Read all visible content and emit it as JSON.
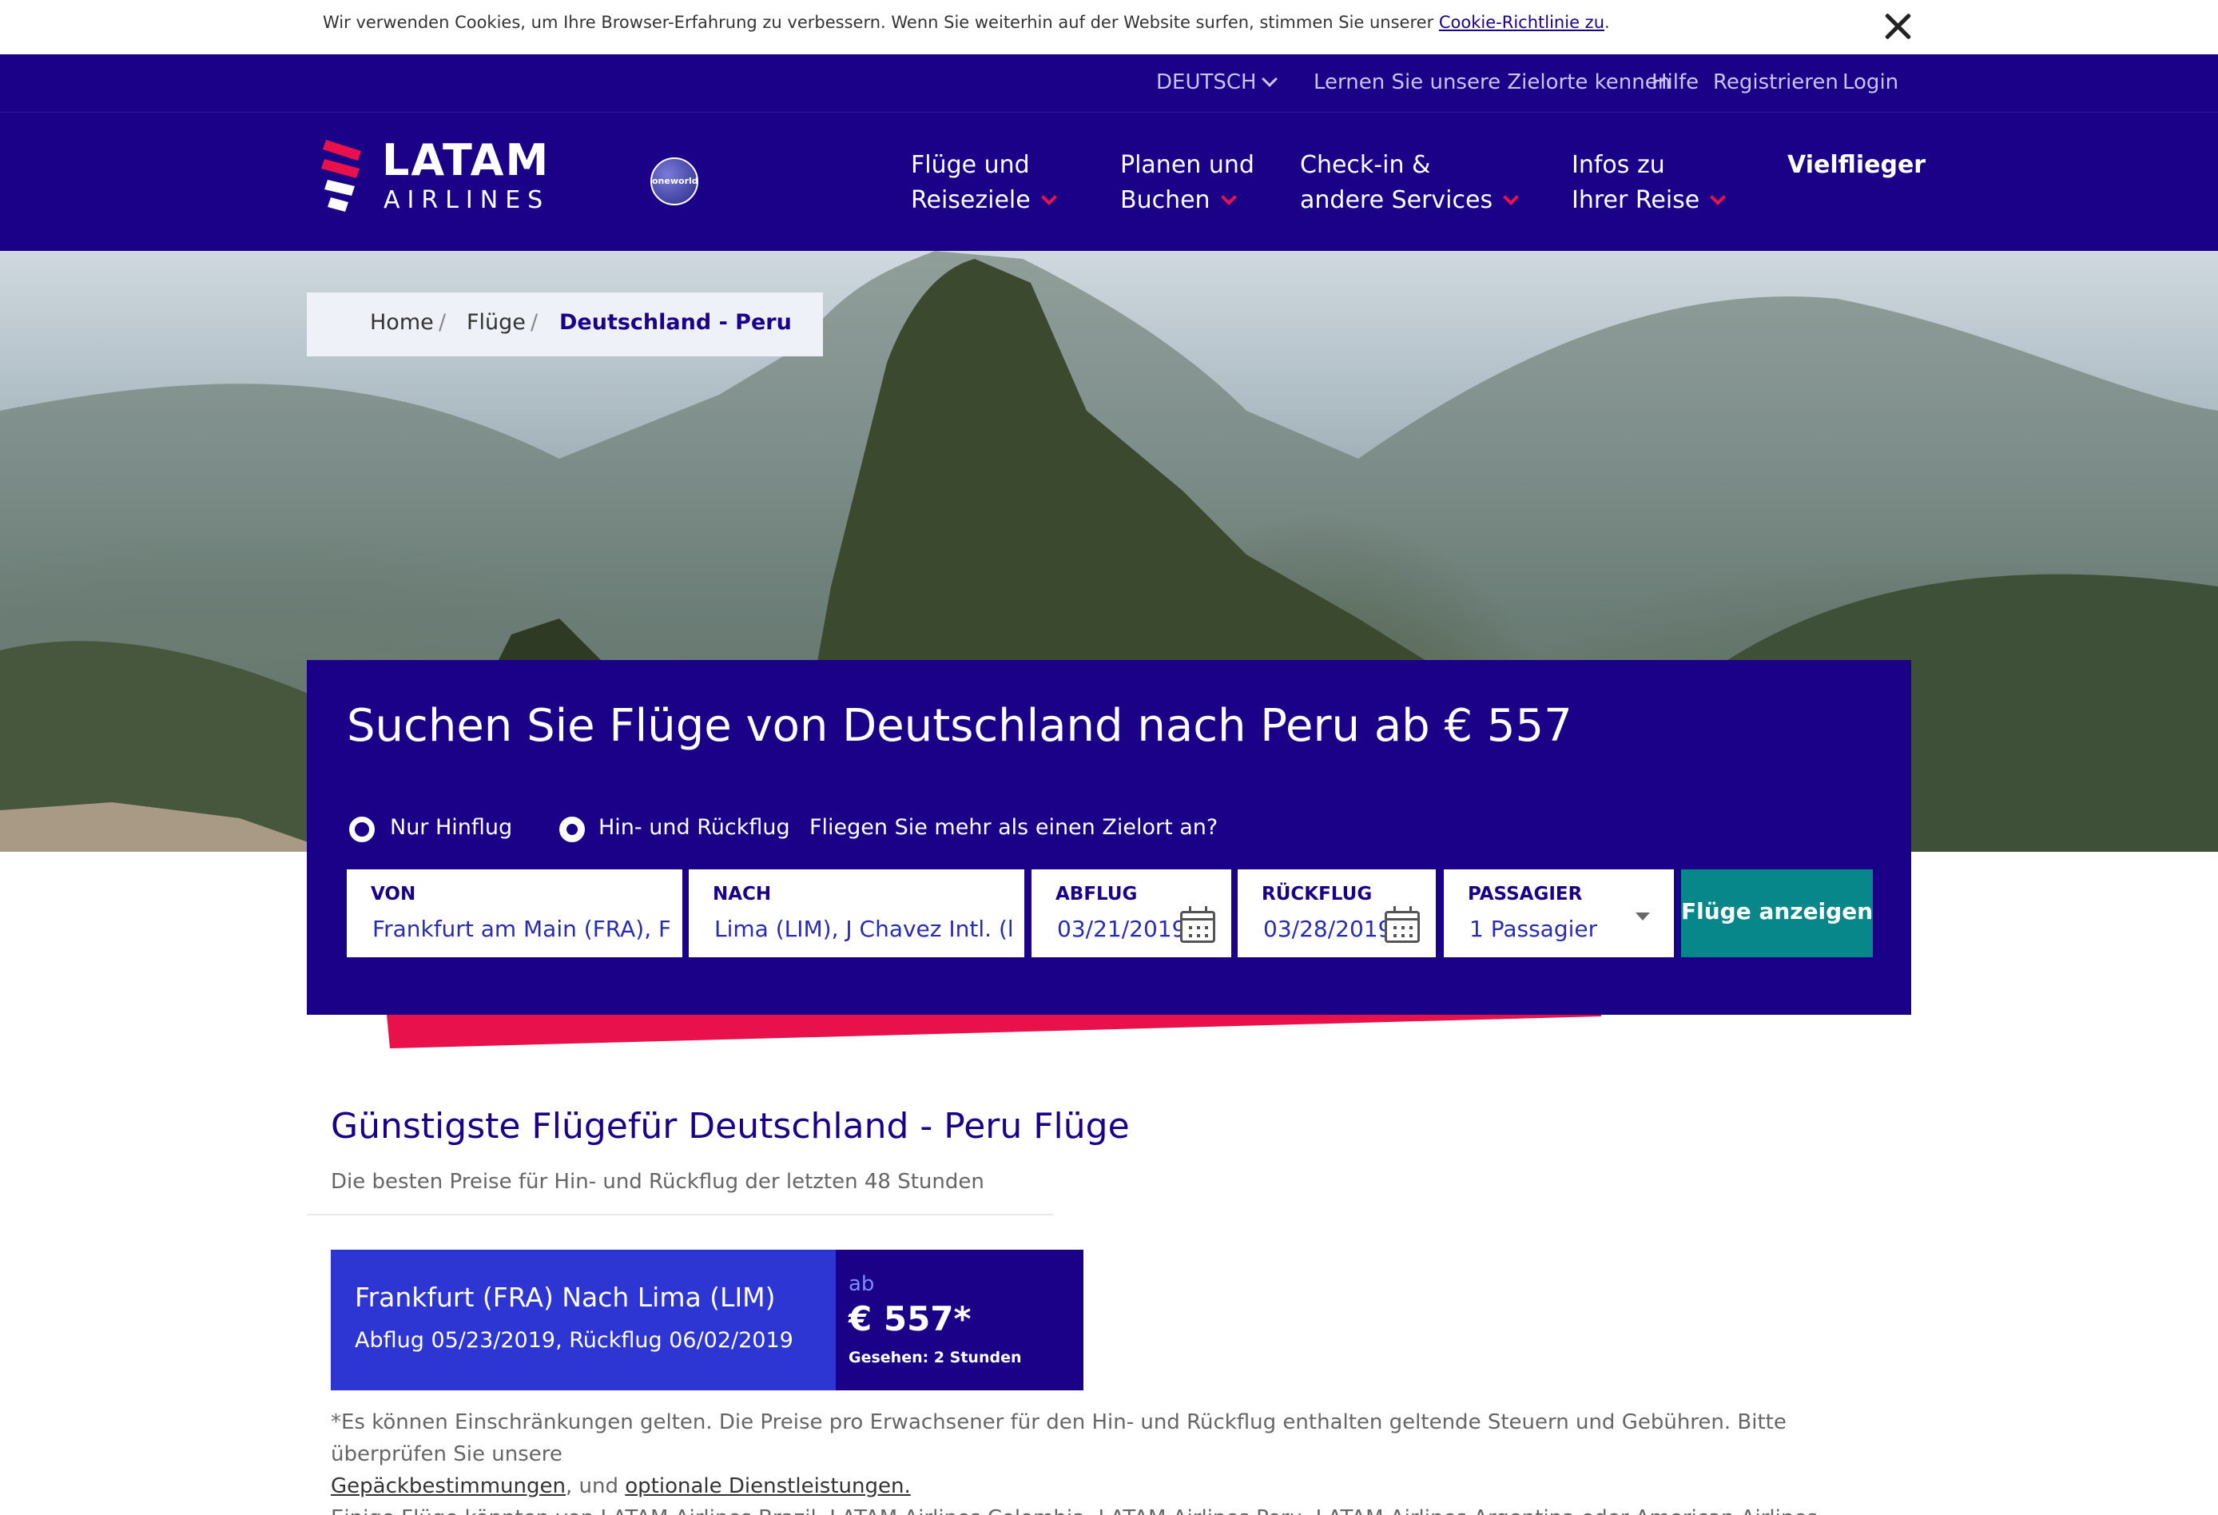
{
  "cookie": {
    "text": "Wir verwenden Cookies, um Ihre Browser-Erfahrung zu verbessern. Wenn Sie weiterhin auf der Website surfen, stimmen Sie unserer ",
    "link": "Cookie-Richtlinie zu",
    "end": "."
  },
  "util_nav": {
    "language": "DEUTSCH",
    "destinations": "Lernen Sie unsere Zielorte kennen",
    "help": "Hilfe",
    "register": "Registrieren",
    "login": "Login"
  },
  "brand": {
    "name": "LATAM",
    "sub": "AIRLINES",
    "alliance": "oneworld"
  },
  "main_nav": [
    {
      "line1": "Flüge und",
      "line2": "Reiseziele"
    },
    {
      "line1": "Planen und",
      "line2": "Buchen"
    },
    {
      "line1": "Check-in &",
      "line2": "andere Services"
    },
    {
      "line1": "Infos zu",
      "line2": "Ihrer Reise"
    },
    {
      "line1": "Vielflieger",
      "line2": ""
    }
  ],
  "breadcrumb": {
    "home": "Home",
    "flights": "Flüge",
    "current": "Deutschland - Peru",
    "sep": "/"
  },
  "search": {
    "title": "Suchen Sie Flüge von Deutschland nach Peru ab € 557",
    "one_way": "Nur Hinflug",
    "round_trip": "Hin- und Rückflug",
    "multi_city": "Fliegen Sie mehr als einen Zielort an?",
    "from_label": "VON",
    "from_value": "Frankfurt am Main (FRA), F",
    "to_label": "NACH",
    "to_value": "Lima (LIM), J Chavez Intl. (l",
    "depart_label": "ABFLUG",
    "depart_value": "03/21/2019",
    "return_label": "RÜCKFLUG",
    "return_value": "03/28/2019",
    "pax_label": "PASSAGIER",
    "pax_value": "1 Passagier",
    "button": "Flüge anzeigen"
  },
  "cheapest": {
    "title": "Günstigste Flügefür Deutschland - Peru Flüge",
    "subtitle": "Die besten Preise für Hin- und Rückflug der letzten 48 Stunden",
    "deal": {
      "route": "Frankfurt (FRA) Nach Lima (LIM)",
      "dates": "Abflug 05/23/2019, Rückflug 06/02/2019",
      "ab": "ab",
      "price": "€ 557*",
      "seen": "Gesehen: 2 Stunden"
    }
  },
  "disclaimer": {
    "line1": "*Es können Einschränkungen gelten. Die Preise pro Erwachsener für den Hin- und Rückflug enthalten geltende Steuern und Gebühren. Bitte überprüfen Sie unsere",
    "link1": "Gepäckbestimmungen",
    "mid": ", und ",
    "link2": "optionale Dienstleistungen.",
    "line2": "Einige Flüge könnten von LATAM Airlines Brazil, LATAM Airlines Colombia, LATAM Airlines Peru, LATAM Airlines Argentina oder American Airlines durchgeführt werden."
  },
  "colors": {
    "brand_indigo": "#1b0088",
    "accent_pink": "#e8114b",
    "button_teal": "#07878a",
    "card_blue": "#2d35d2"
  }
}
